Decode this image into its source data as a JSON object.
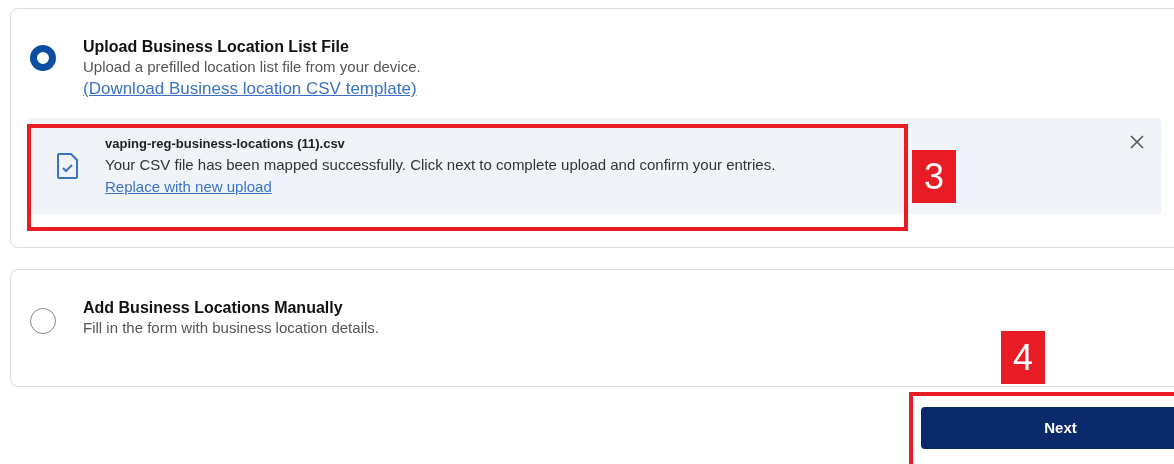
{
  "options": [
    {
      "title": "Upload Business Location List File",
      "description": "Upload a prefilled location list file from your device.",
      "selected": true,
      "link": "(Download Business location CSV template)",
      "upload": {
        "file_name": "vaping-reg-business-locations (11).csv",
        "message": "Your CSV file has been mapped successfully. Click next to complete upload and confirm your entries.",
        "link": "Replace with new upload"
      }
    },
    {
      "title": "Add Business Locations Manually",
      "description": "Fill in the form with business location details.",
      "selected": false
    }
  ],
  "next_button": "Next",
  "annotations": [
    {
      "number": "3"
    },
    {
      "number": "4"
    }
  ]
}
